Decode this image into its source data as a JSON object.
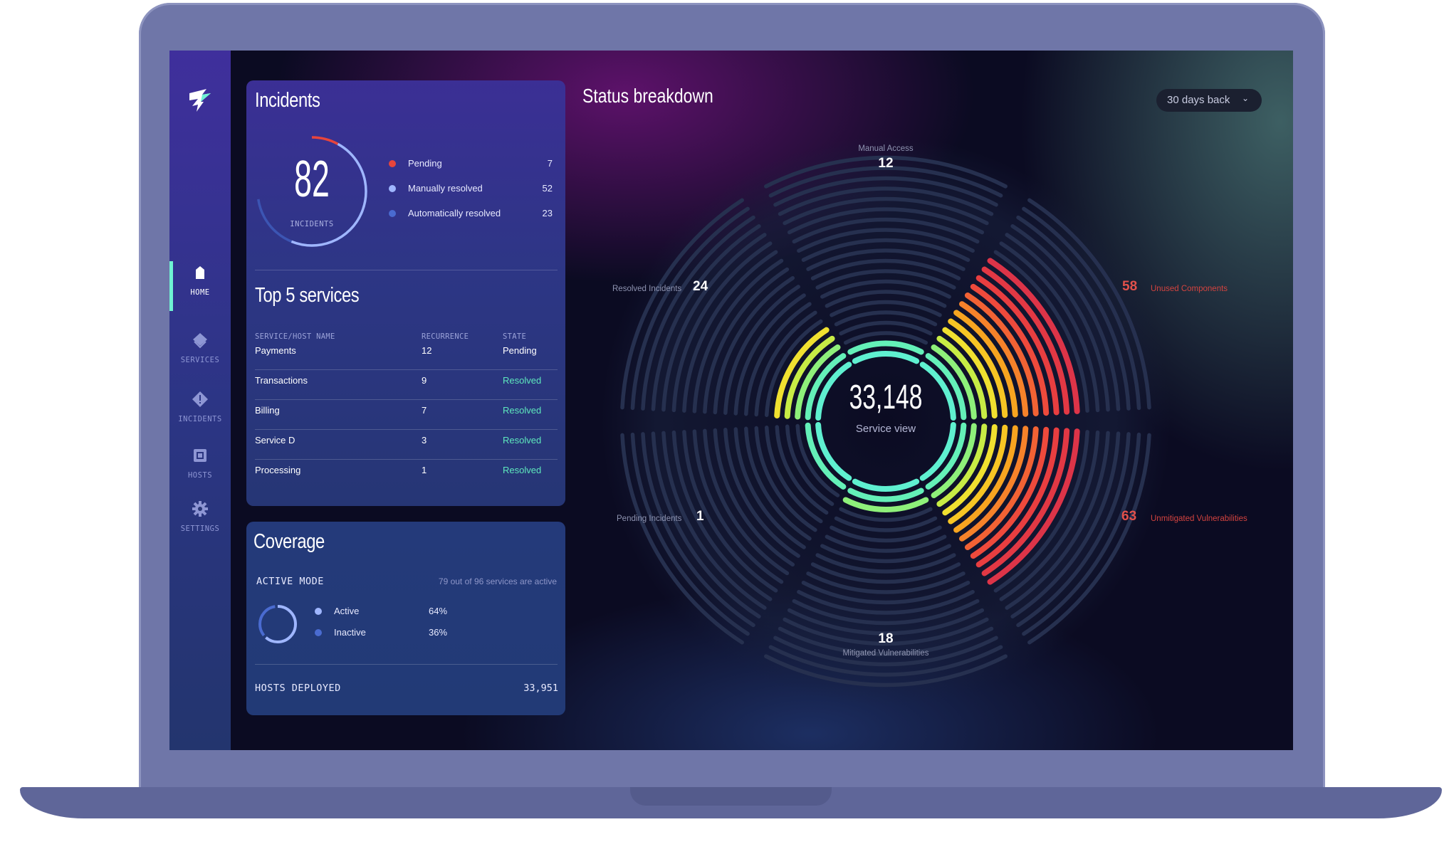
{
  "sidebar": {
    "items": [
      {
        "label": "HOME",
        "icon": "home-icon",
        "active": true
      },
      {
        "label": "SERVICES",
        "icon": "services-icon",
        "active": false
      },
      {
        "label": "INCIDENTS",
        "icon": "incidents-icon",
        "active": false
      },
      {
        "label": "HOSTS",
        "icon": "hosts-icon",
        "active": false
      },
      {
        "label": "SETTINGS",
        "icon": "settings-icon",
        "active": false
      }
    ]
  },
  "incidents": {
    "title": "Incidents",
    "total": "82",
    "total_label": "INCIDENTS",
    "legend": [
      {
        "label": "Pending",
        "value": "7",
        "color": "#e8453c"
      },
      {
        "label": "Manually resolved",
        "value": "52",
        "color": "#9fb6ff"
      },
      {
        "label": "Automatically resolved",
        "value": "23",
        "color": "#4a6bd0"
      }
    ]
  },
  "top_services": {
    "title": "Top 5 services",
    "headers": {
      "name": "SERVICE/HOST NAME",
      "recurrence": "RECURRENCE",
      "state": "STATE"
    },
    "rows": [
      {
        "name": "Payments",
        "recurrence": "12",
        "state": "Pending"
      },
      {
        "name": "Transactions",
        "recurrence": "9",
        "state": "Resolved"
      },
      {
        "name": "Billing",
        "recurrence": "7",
        "state": "Resolved"
      },
      {
        "name": "Service D",
        "recurrence": "3",
        "state": "Resolved"
      },
      {
        "name": "Processing",
        "recurrence": "1",
        "state": "Resolved"
      }
    ]
  },
  "coverage": {
    "title": "Coverage",
    "mode_label": "ACTIVE MODE",
    "summary": "79 out of 96 services are active",
    "legend": [
      {
        "label": "Active",
        "value": "64%",
        "fraction": 0.64,
        "color": "#9fb6ff"
      },
      {
        "label": "Inactive",
        "value": "36%",
        "fraction": 0.36,
        "color": "#4a6bd0"
      }
    ],
    "hosts_label": "HOSTS DEPLOYED",
    "hosts_value": "33,951"
  },
  "status": {
    "title": "Status breakdown",
    "range_selector": "30 days back",
    "center_value": "33,148",
    "center_label": "Service view",
    "segments": {
      "manual_access": {
        "label": "Manual Access",
        "value": "12"
      },
      "resolved_incidents": {
        "label": "Resolved Incidents",
        "value": "24"
      },
      "unused_components": {
        "label": "Unused Components",
        "value": "58"
      },
      "pending_incidents": {
        "label": "Pending Incidents",
        "value": "1"
      },
      "unmitigated_vulnerabilities": {
        "label": "Unmitigated Vulnerabilities",
        "value": "63"
      },
      "mitigated_vulnerabilities": {
        "label": "Mitigated Vulnerabilities",
        "value": "18"
      }
    }
  },
  "colors": {
    "accent": "#6ff2d3",
    "danger": "#e2514b",
    "resolved": "#5ee8bd"
  }
}
